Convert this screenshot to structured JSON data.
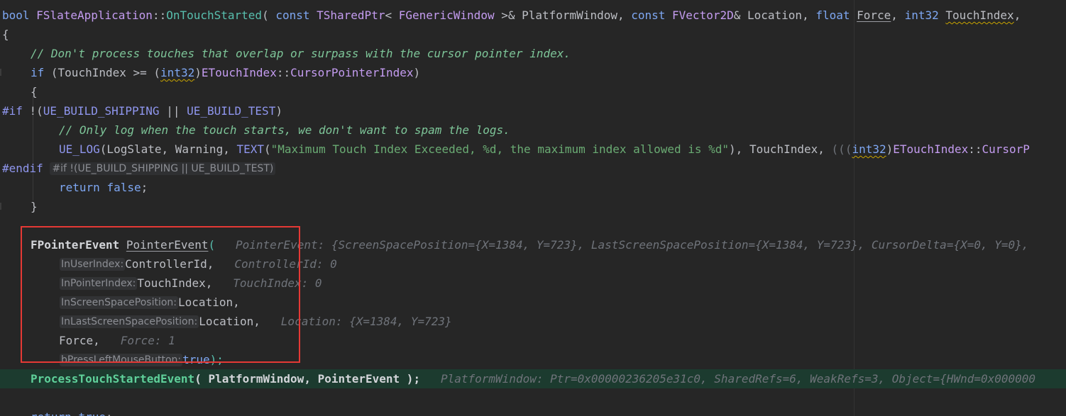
{
  "code": {
    "l1": {
      "a": "bool ",
      "b": "FSlateApplication",
      "c": "::",
      "d": "OnTouchStarted",
      "e": "( ",
      "f": "const ",
      "g": "TSharedPtr",
      "h": "< ",
      "i": "FGenericWindow",
      "j": " >& ",
      "k": "PlatformWindow",
      "l": ", ",
      "m": "const ",
      "n": "FVector2D",
      "o": "& ",
      "p": "Location",
      "q": ", ",
      "r": "float ",
      "s": "Force",
      "t": ", ",
      "u": "int32 ",
      "v": "TouchIndex",
      "w": ","
    },
    "l2": "{",
    "l3": "// Don't process touches that overlap or surpass with the cursor pointer index.",
    "l4": {
      "a": "if ",
      "b": "(TouchIndex >= ",
      "c": "(",
      "d": "int32",
      "e": ")",
      "f": "ETouchIndex",
      "g": "::",
      "h": "CursorPointerIndex",
      "i": ")"
    },
    "l5": "{",
    "l6": {
      "a": "#if ",
      "b": "!(",
      "c": "UE_BUILD_SHIPPING",
      "d": " || ",
      "e": "UE_BUILD_TEST",
      "f": ")"
    },
    "l7": "// Only log when the touch starts, we don't want to spam the logs.",
    "l8": {
      "a": "UE_LOG",
      "b": "(LogSlate, ",
      "c": "Warning",
      "d": ", ",
      "e": "TEXT",
      "f": "(",
      "g": "\"Maximum Touch Index Exceeded, %d, the maximum index allowed is %d\"",
      "h": "), TouchIndex, ",
      "i": "(((",
      "j": "int32",
      "k": ")",
      "l": "ETouchIndex",
      "m": "::",
      "n": "CursorP"
    },
    "l9": {
      "a": "#endif",
      "b": "#if !(UE_BUILD_SHIPPING || UE_BUILD_TEST)"
    },
    "l10": {
      "a": "return ",
      "b": "false",
      "c": ";"
    },
    "l11": "}",
    "l13": {
      "a": "FPointerEvent ",
      "b": "PointerEvent",
      "c": "(",
      "d": "PointerEvent: {ScreenSpacePosition={X=1384, Y=723}, LastScreenSpacePosition={X=1384, Y=723}, CursorDelta={X=0, Y=0},"
    },
    "l14": {
      "hint": "InUserIndex:",
      "a": "ControllerId",
      "b": ",",
      "dbg": "ControllerId: 0"
    },
    "l15": {
      "hint": "InPointerIndex:",
      "a": "TouchIndex",
      "b": ",",
      "dbg": "TouchIndex: 0"
    },
    "l16": {
      "hint": "InScreenSpacePosition:",
      "a": "Location",
      "b": ","
    },
    "l17": {
      "hint": "InLastScreenSpacePosition:",
      "a": "Location",
      "b": ",",
      "dbg": "Location: {X=1384, Y=723}"
    },
    "l18": {
      "a": "Force",
      "b": ",",
      "dbg": "Force: 1"
    },
    "l19": {
      "hint": "bPressLeftMouseButton:",
      "a": "true",
      "b": ");"
    },
    "l20": {
      "a": "ProcessTouchStartedEvent",
      "b": "( ",
      "c": "PlatformWindow",
      "d": ", ",
      "e": "PointerEvent",
      "f": " );",
      "dbg": "PlatformWindow: Ptr=0x00000236205e31c0, SharedRefs=6, WeakRefs=3, Object={HWnd=0x000000"
    },
    "l22": {
      "a": "return ",
      "b": "true",
      "c": ";"
    }
  }
}
